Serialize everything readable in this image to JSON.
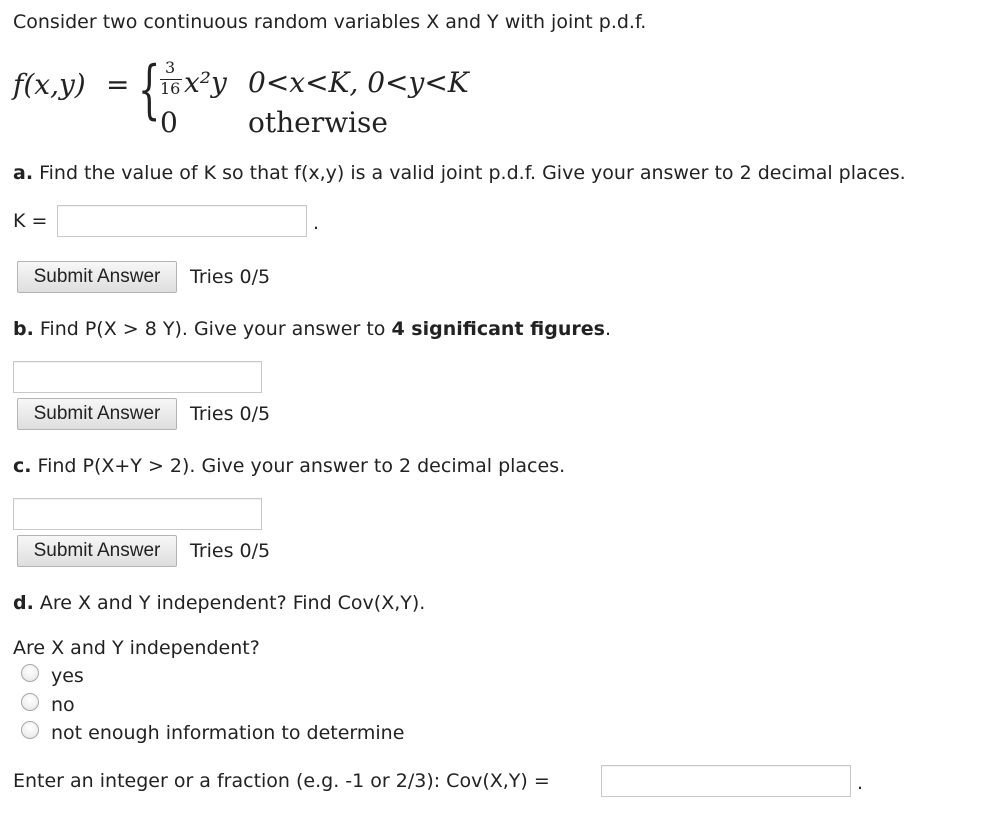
{
  "intro": "Consider two continuous random variables X and Y with joint p.d.f.",
  "formula": {
    "lhs": "f(x,y)",
    "equals": "=",
    "numerator": "3",
    "denominator": "16",
    "expr": "x²y",
    "condition": "0<x<K, 0<y<K",
    "zero": "0",
    "otherwise": "otherwise"
  },
  "part_a": {
    "letter": "a.",
    "text": " Find the value of K so that f(x,y) is a valid joint p.d.f. Give your answer to 2 decimal places.",
    "input_label": "K =",
    "input_value": "",
    "trailing": ".",
    "button": "Submit Answer",
    "tries": "Tries 0/5"
  },
  "part_b": {
    "letter": "b.",
    "text_before": " Find P(X > 8 Y). Give your answer to ",
    "text_bold": "4 significant figures",
    "text_after": ".",
    "input_value": "",
    "button": "Submit Answer",
    "tries": "Tries 0/5"
  },
  "part_c": {
    "letter": "c.",
    "text": " Find P(X+Y > 2). Give your answer to 2 decimal places.",
    "input_value": "",
    "button": "Submit Answer",
    "tries": "Tries 0/5"
  },
  "part_d": {
    "letter": "d.",
    "text": " Are X and Y independent? Find Cov(X,Y).",
    "question": "Are X and Y independent?",
    "options": [
      "yes",
      "no",
      "not enough information to determine"
    ],
    "cov_label": "Enter an integer or a fraction (e.g. -1 or 2/3): Cov(X,Y) =",
    "cov_value": "",
    "trailing": "."
  }
}
